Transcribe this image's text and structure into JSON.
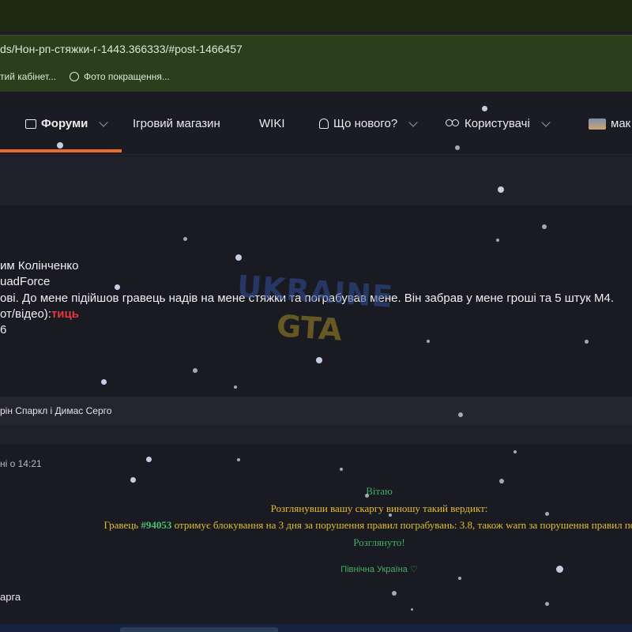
{
  "browser": {
    "url": "ds/Нон-рп-стяжки-г-1443.366333/#post-1466457",
    "bookmarks": [
      {
        "label": "тий кабінет...",
        "icon": "bookmark-page-icon"
      },
      {
        "label": "Фото покращення...",
        "icon": "openai-icon"
      }
    ]
  },
  "nav": {
    "items": [
      {
        "label": "Форуми",
        "icon": "chat-icon",
        "active": true,
        "dropdown": true
      },
      {
        "label": "Ігровий магазин",
        "dropdown": false
      },
      {
        "label": "WIKI",
        "dropdown": false
      },
      {
        "label": "Що нового?",
        "icon": "bell-icon",
        "dropdown": true
      },
      {
        "label": "Користувачі",
        "icon": "users-icon",
        "dropdown": true
      },
      {
        "label": "мак",
        "icon": "avatar-icon"
      }
    ],
    "accent_color": "#ec6a2c"
  },
  "post": {
    "lines": [
      "им Колінченко",
      "uadForce",
      "ові. До мене підійшов гравець надів на мене стяжки та пограбував мене. Він забрав у мене гроші та 5 штук М4.",
      "от/відео):",
      "6"
    ],
    "proof_link": "тиць"
  },
  "reactions": {
    "text": "рін Спаркл і Димас Серго"
  },
  "reply": {
    "date": "ні о 14:21",
    "greeting": "Вітаю",
    "intro": "Розглянувши вашу скаргу виношу такий вердикт:",
    "verdict_prefix": "Гравець ",
    "verdict_id": "#94053",
    "verdict_rest": " отримує блокування на 3 дня за порушення правил пограбувань: 3.8, також warn за порушення правил пограб",
    "status": "Розглянуто!",
    "signature": "Північна Україна ♡",
    "author": "арга"
  },
  "watermark": {
    "line1": "UKRAINE",
    "line2": "GTA"
  },
  "colors": {
    "verdict_yellow": "#e4bf2c",
    "reply_green": "#3fae68",
    "proof_red": "#e0393e"
  }
}
